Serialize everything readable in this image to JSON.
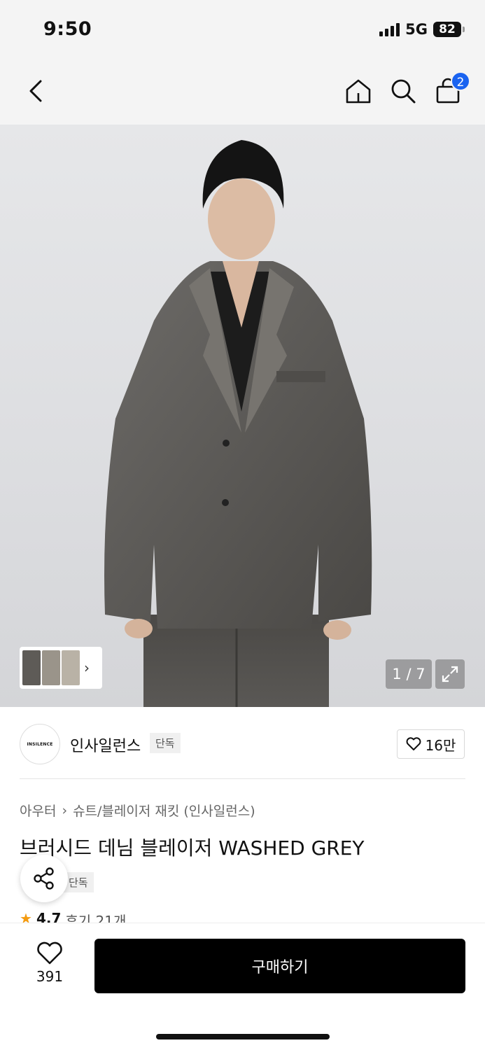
{
  "status": {
    "time": "9:50",
    "network": "5G",
    "battery": "82"
  },
  "nav": {
    "cart_count": "2"
  },
  "gallery": {
    "counter": "1 / 7",
    "thumb_arrow": "›"
  },
  "brand": {
    "logo_text": "INSILENCE",
    "name": "인사일런스",
    "tag": "단독",
    "likes": "16만"
  },
  "product": {
    "breadcrumb": [
      "아우터",
      "슈트/블레이저 재킷 (인사일런스)"
    ],
    "breadcrumb_sep": "›",
    "title": "브러시드 데님 블레이저 WASHED GREY",
    "tag": "단독",
    "rating": "4.7",
    "review_label": "후기 21개"
  },
  "bottom": {
    "wish_count": "391",
    "buy_label": "구매하기"
  },
  "colors": {
    "accent": "#1a63f0",
    "buy_button": "#000000",
    "star": "#f49b10"
  }
}
